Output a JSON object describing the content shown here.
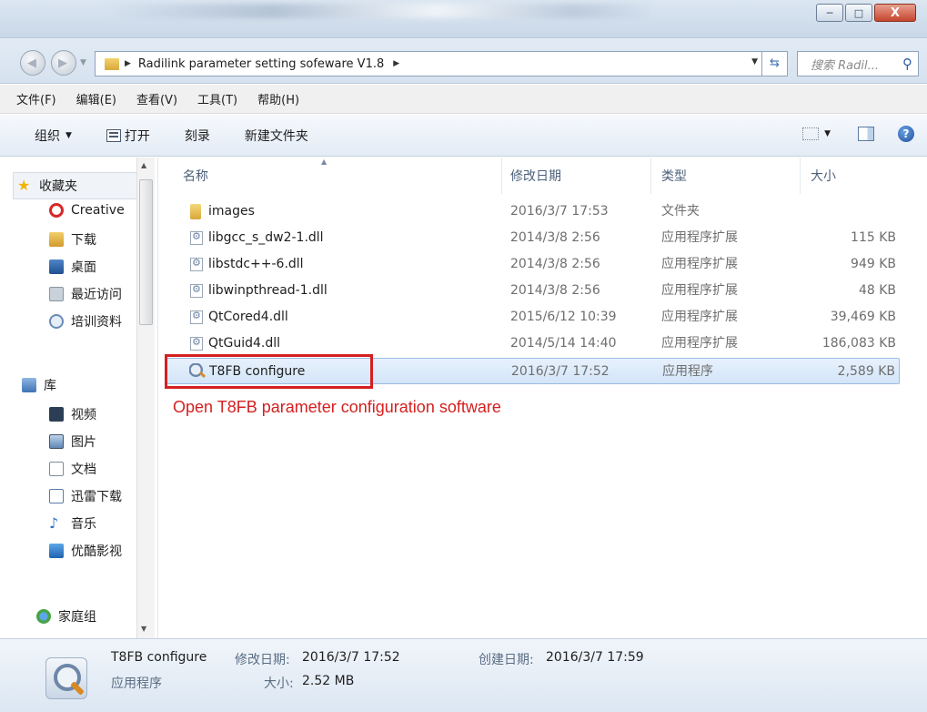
{
  "window": {
    "controls": {
      "minimize": "─",
      "maximize": "□",
      "close": "X"
    }
  },
  "address": {
    "path": "Radilink parameter setting sofeware V1.8",
    "search_placeholder": "搜索 Radil..."
  },
  "menu": [
    "文件(F)",
    "编辑(E)",
    "查看(V)",
    "工具(T)",
    "帮助(H)"
  ],
  "toolbar": {
    "organize": "组织",
    "open": "打开",
    "burn": "刻录",
    "new_folder": "新建文件夹"
  },
  "sidebar": {
    "favorites": "收藏夹",
    "items": [
      "Creative",
      "下载",
      "桌面",
      "最近访问",
      "培训资料"
    ],
    "library": "库",
    "library_items": [
      "视频",
      "图片",
      "文档",
      "迅雷下载",
      "音乐",
      "优酷影视"
    ],
    "homegroup": "家庭组"
  },
  "columns": {
    "name": "名称",
    "date": "修改日期",
    "type": "类型",
    "size": "大小"
  },
  "files": [
    {
      "name": "images",
      "date": "2016/3/7 17:53",
      "type": "文件夹",
      "size": "",
      "icon": "folder-icon"
    },
    {
      "name": "libgcc_s_dw2-1.dll",
      "date": "2014/3/8 2:56",
      "type": "应用程序扩展",
      "size": "115 KB",
      "icon": "dll-icon"
    },
    {
      "name": "libstdc++-6.dll",
      "date": "2014/3/8 2:56",
      "type": "应用程序扩展",
      "size": "949 KB",
      "icon": "dll-icon"
    },
    {
      "name": "libwinpthread-1.dll",
      "date": "2014/3/8 2:56",
      "type": "应用程序扩展",
      "size": "48 KB",
      "icon": "dll-icon"
    },
    {
      "name": "QtCored4.dll",
      "date": "2015/6/12 10:39",
      "type": "应用程序扩展",
      "size": "39,469 KB",
      "icon": "dll-icon"
    },
    {
      "name": "QtGuid4.dll",
      "date": "2014/5/14 14:40",
      "type": "应用程序扩展",
      "size": "186,083 KB",
      "icon": "dll-icon"
    },
    {
      "name": "T8FB configure",
      "date": "2016/3/7 17:52",
      "type": "应用程序",
      "size": "2,589 KB",
      "icon": "exe-icon"
    }
  ],
  "annotation": "Open T8FB parameter configuration software",
  "details": {
    "name": "T8FB configure",
    "modified_label": "修改日期:",
    "modified": "2016/3/7 17:52",
    "created_label": "创建日期:",
    "created": "2016/3/7 17:59",
    "type": "应用程序",
    "size_label": "大小:",
    "size": "2.52 MB"
  },
  "colors": {
    "annotation": "#d42020",
    "selection": "#d3e5f8"
  }
}
